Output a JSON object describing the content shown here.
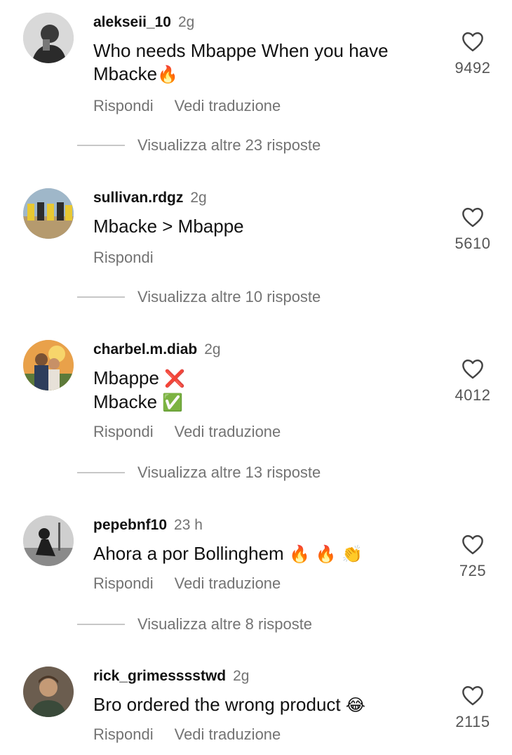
{
  "comments": [
    {
      "username": "alekseii_10",
      "time": "2g",
      "text_line1": "Who needs Mbappe When you have",
      "text_line2": "Mbacke",
      "emoji": "🔥",
      "reply": "Rispondi",
      "translate": "Vedi traduzione",
      "likes": "9492",
      "more_replies": "Visualizza altre 23 risposte"
    },
    {
      "username": "sullivan.rdgz",
      "time": "2g",
      "text": "Mbacke > Mbappe",
      "reply": "Rispondi",
      "likes": "5610",
      "more_replies": "Visualizza altre 10 risposte"
    },
    {
      "username": "charbel.m.diab",
      "time": "2g",
      "text_line1": "Mbappe",
      "emoji1": "❌",
      "text_line2": "Mbacke",
      "emoji2": "✅",
      "reply": "Rispondi",
      "translate": "Vedi traduzione",
      "likes": "4012",
      "more_replies": "Visualizza altre 13 risposte"
    },
    {
      "username": "pepebnf10",
      "time": "23 h",
      "text": "Ahora a por Bollinghem",
      "emojis": "🔥 🔥 👏",
      "reply": "Rispondi",
      "translate": "Vedi traduzione",
      "likes": "725",
      "more_replies": "Visualizza altre 8 risposte"
    },
    {
      "username": "rick_grimesssstwd",
      "time": "2g",
      "text": "Bro ordered the wrong product",
      "emoji": "😂",
      "reply": "Rispondi",
      "translate": "Vedi traduzione",
      "likes": "2115"
    }
  ],
  "icons": {
    "like": "heart-outline-icon"
  },
  "colors": {
    "secondary_text": "#737373",
    "divider": "#c7c7c7"
  }
}
